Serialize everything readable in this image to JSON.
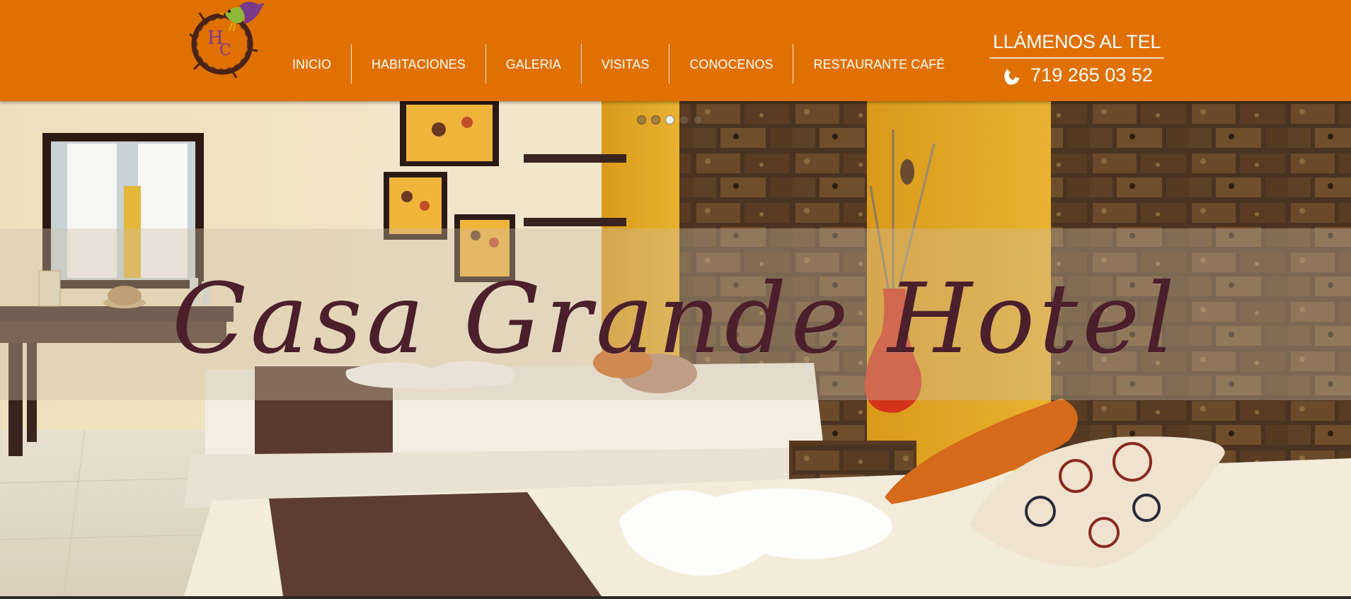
{
  "logo": {
    "letters": "HC"
  },
  "nav": {
    "items": [
      {
        "label": "INICIO"
      },
      {
        "label": "HABITACIONES"
      },
      {
        "label": "GALERIA"
      },
      {
        "label": "VISITAS"
      },
      {
        "label": "CONOCENOS"
      },
      {
        "label": "RESTAURANTE CAFÉ"
      }
    ]
  },
  "contact": {
    "label": "LLÁMENOS AL TEL",
    "phone": "719 265 03 52",
    "icon": "phone-icon"
  },
  "hero": {
    "title": "Casa Grande Hotel",
    "slides_count": 5,
    "active_slide": 3
  },
  "colors": {
    "header_bg": "#e07000",
    "title_color": "#4b1f2b",
    "accent_purple": "#7a3a8a"
  }
}
